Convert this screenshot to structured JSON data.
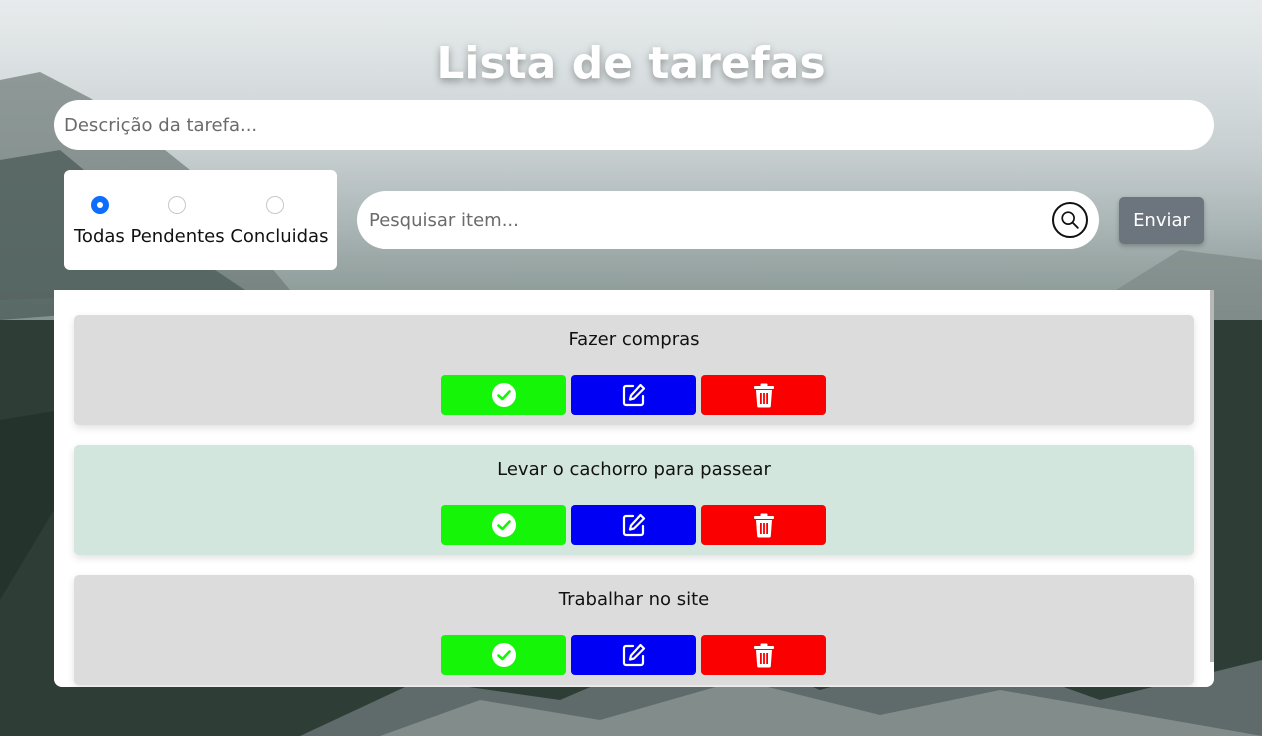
{
  "page": {
    "title": "Lista de tarefas"
  },
  "task_form": {
    "description_placeholder": "Descrição da tarefa...",
    "description_value": "",
    "submit_label": "Enviar"
  },
  "filters": {
    "options": [
      {
        "label": "Todas",
        "checked": true
      },
      {
        "label": "Pendentes",
        "checked": false
      },
      {
        "label": "Concluidas",
        "checked": false
      }
    ],
    "labels_text": "Todas Pendentes Concluidas"
  },
  "search": {
    "placeholder": "Pesquisar item...",
    "value": "",
    "icon": "search-icon"
  },
  "tasks": [
    {
      "text": "Fazer compras",
      "status": "pending",
      "bg_color": "#dcdcdc"
    },
    {
      "text": "Levar o cachorro para passear",
      "status": "done",
      "bg_color": "#d3e6de"
    },
    {
      "text": "Trabalhar no site",
      "status": "pending",
      "bg_color": "#dcdcdc"
    }
  ],
  "task_actions": {
    "complete": {
      "icon": "check-circle-icon",
      "color": "#14f507"
    },
    "edit": {
      "icon": "edit-icon",
      "color": "#0000f5"
    },
    "delete": {
      "icon": "trash-icon",
      "color": "#fa0000"
    }
  }
}
